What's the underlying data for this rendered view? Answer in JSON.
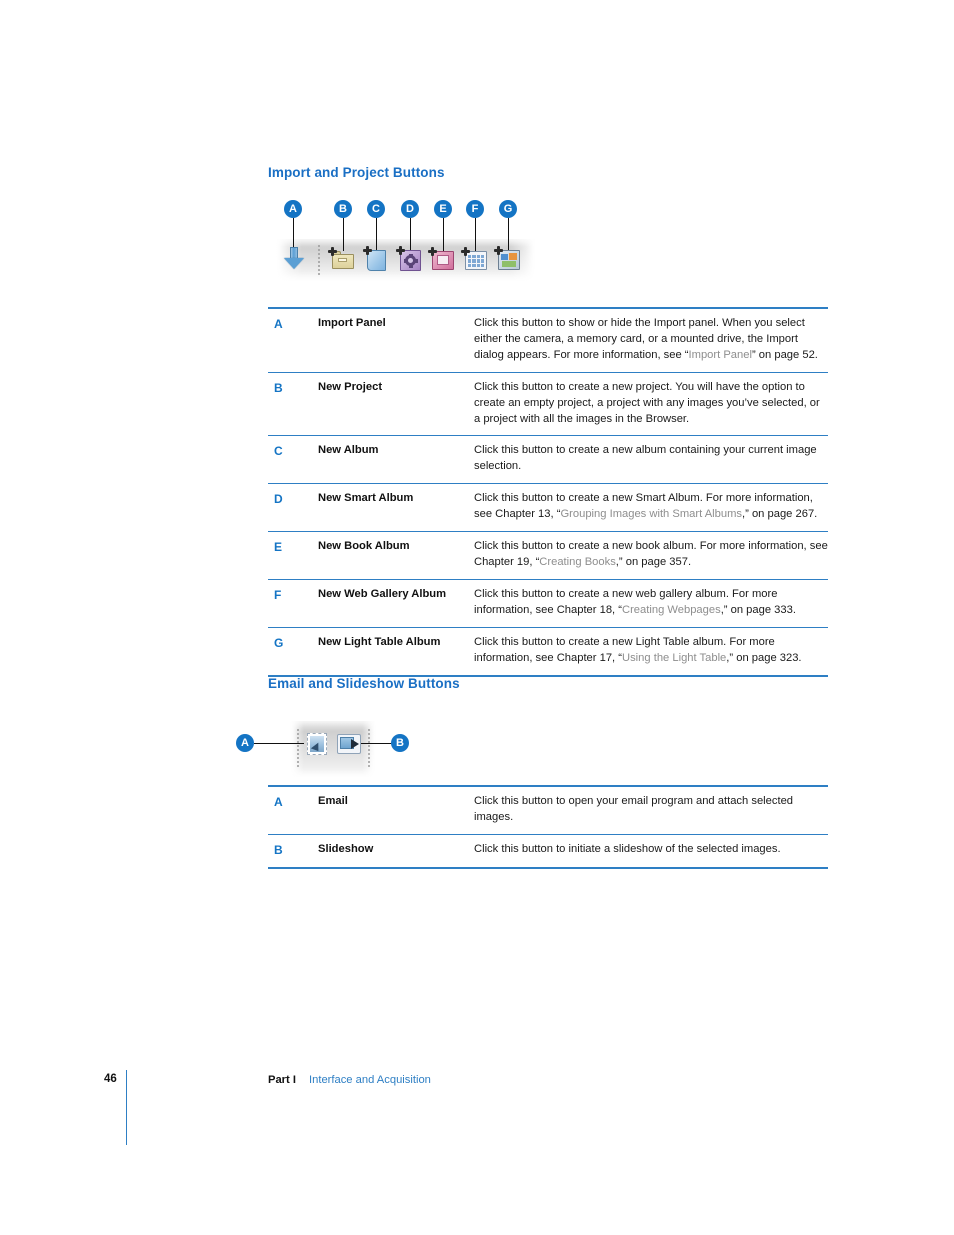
{
  "sections": {
    "import": {
      "heading": "Import and Project Buttons",
      "figure": {
        "callouts": [
          "A",
          "B",
          "C",
          "D",
          "E",
          "F",
          "G"
        ],
        "icons": [
          "import-arrow-down-icon",
          "new-project-folder-icon",
          "new-album-page-icon",
          "new-smart-album-gear-icon",
          "new-book-album-icon",
          "new-web-gallery-grid-icon",
          "new-light-table-icon"
        ]
      },
      "rows": [
        {
          "letter": "A",
          "name": "Import Panel",
          "desc_before": "Click this button to show or hide the Import panel. When you select either the camera, a memory card, or a mounted drive, the Import dialog appears. For more information, see “",
          "xref": "Import Panel",
          "desc_after": "” on page 52."
        },
        {
          "letter": "B",
          "name": "New Project",
          "desc_before": "Click this button to create a new project. You will have the option to create an empty project, a project with any images you’ve selected, or a project with all the images in the Browser.",
          "xref": "",
          "desc_after": ""
        },
        {
          "letter": "C",
          "name": "New Album",
          "desc_before": "Click this button to create a new album containing your current image selection.",
          "xref": "",
          "desc_after": ""
        },
        {
          "letter": "D",
          "name": "New Smart Album",
          "desc_before": "Click this button to create a new Smart Album. For more information, see Chapter 13, “",
          "xref": "Grouping Images with Smart Albums",
          "desc_after": ",” on page 267."
        },
        {
          "letter": "E",
          "name": "New Book Album",
          "desc_before": "Click this button to create a new book album. For more information, see Chapter 19, “",
          "xref": "Creating Books",
          "desc_after": ",” on page 357."
        },
        {
          "letter": "F",
          "name": "New Web Gallery Album",
          "desc_before": "Click this button to create a new web gallery album. For more information, see Chapter 18, “",
          "xref": "Creating Webpages",
          "desc_after": ",” on page 333."
        },
        {
          "letter": "G",
          "name": "New Light Table Album",
          "desc_before": "Click this button to create a new Light Table album. For more information, see Chapter 17, “",
          "xref": "Using the Light Table",
          "desc_after": ",” on page 323."
        }
      ]
    },
    "email": {
      "heading": "Email and Slideshow Buttons",
      "figure": {
        "callouts": [
          "A",
          "B"
        ],
        "icons": [
          "email-stamp-icon",
          "slideshow-play-icon"
        ]
      },
      "rows": [
        {
          "letter": "A",
          "name": "Email",
          "desc_before": "Click this button to open your email program and attach selected images.",
          "xref": "",
          "desc_after": ""
        },
        {
          "letter": "B",
          "name": "Slideshow",
          "desc_before": "Click this button to initiate a slideshow of the selected images.",
          "xref": "",
          "desc_after": ""
        }
      ]
    }
  },
  "footer": {
    "page_number": "46",
    "part": "Part I",
    "part_title": "Interface and Acquisition"
  },
  "colors": {
    "heading_blue": "#1a6fc4",
    "rule_blue": "#2e7fc4",
    "callout_blue": "#1474c4",
    "xref_grey": "#8e8e8e",
    "body_text": "#1a1a1a"
  }
}
